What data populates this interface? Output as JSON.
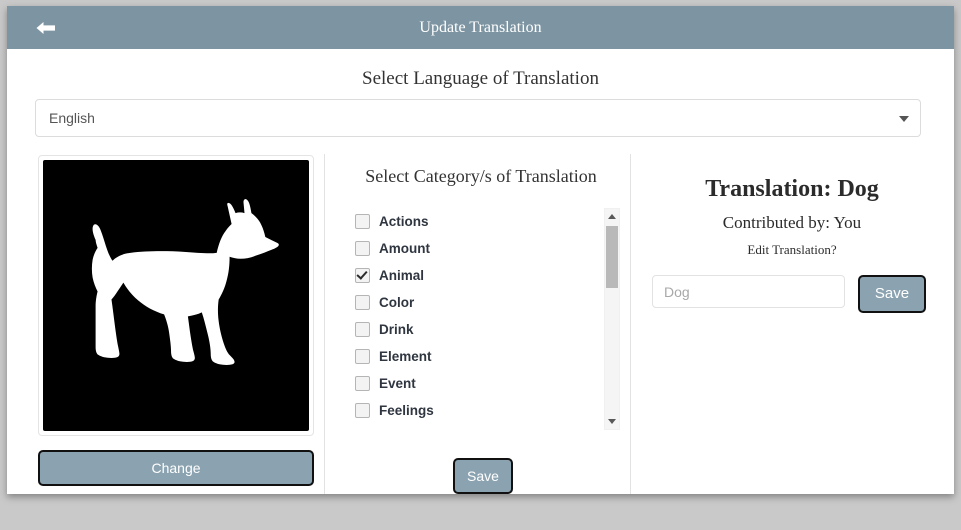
{
  "titlebar": {
    "title": "Update Translation",
    "back_icon": "arrow-left-icon"
  },
  "language": {
    "heading": "Select Language of Translation",
    "selected": "English",
    "caret_icon": "chevron-down-icon"
  },
  "image_panel": {
    "image_alt": "dog-silhouette",
    "change_label": "Change"
  },
  "categories": {
    "heading": "Select Category/s of Translation",
    "items": [
      {
        "label": "Actions",
        "checked": false
      },
      {
        "label": "Amount",
        "checked": false
      },
      {
        "label": "Animal",
        "checked": true
      },
      {
        "label": "Color",
        "checked": false
      },
      {
        "label": "Drink",
        "checked": false
      },
      {
        "label": "Element",
        "checked": false
      },
      {
        "label": "Event",
        "checked": false
      },
      {
        "label": "Feelings",
        "checked": false
      }
    ],
    "save_label": "Save",
    "scroll_up_icon": "triangle-up-icon",
    "scroll_down_icon": "triangle-down-icon"
  },
  "translation": {
    "title": "Translation: Dog",
    "contributed_by": "Contributed by: You",
    "edit_prompt": "Edit Translation?",
    "input_value": "",
    "input_placeholder": "Dog",
    "save_label": "Save"
  },
  "colors": {
    "header": "#7d95a2",
    "button": "#8ba3b0",
    "page_bg": "#c9c9c9"
  }
}
